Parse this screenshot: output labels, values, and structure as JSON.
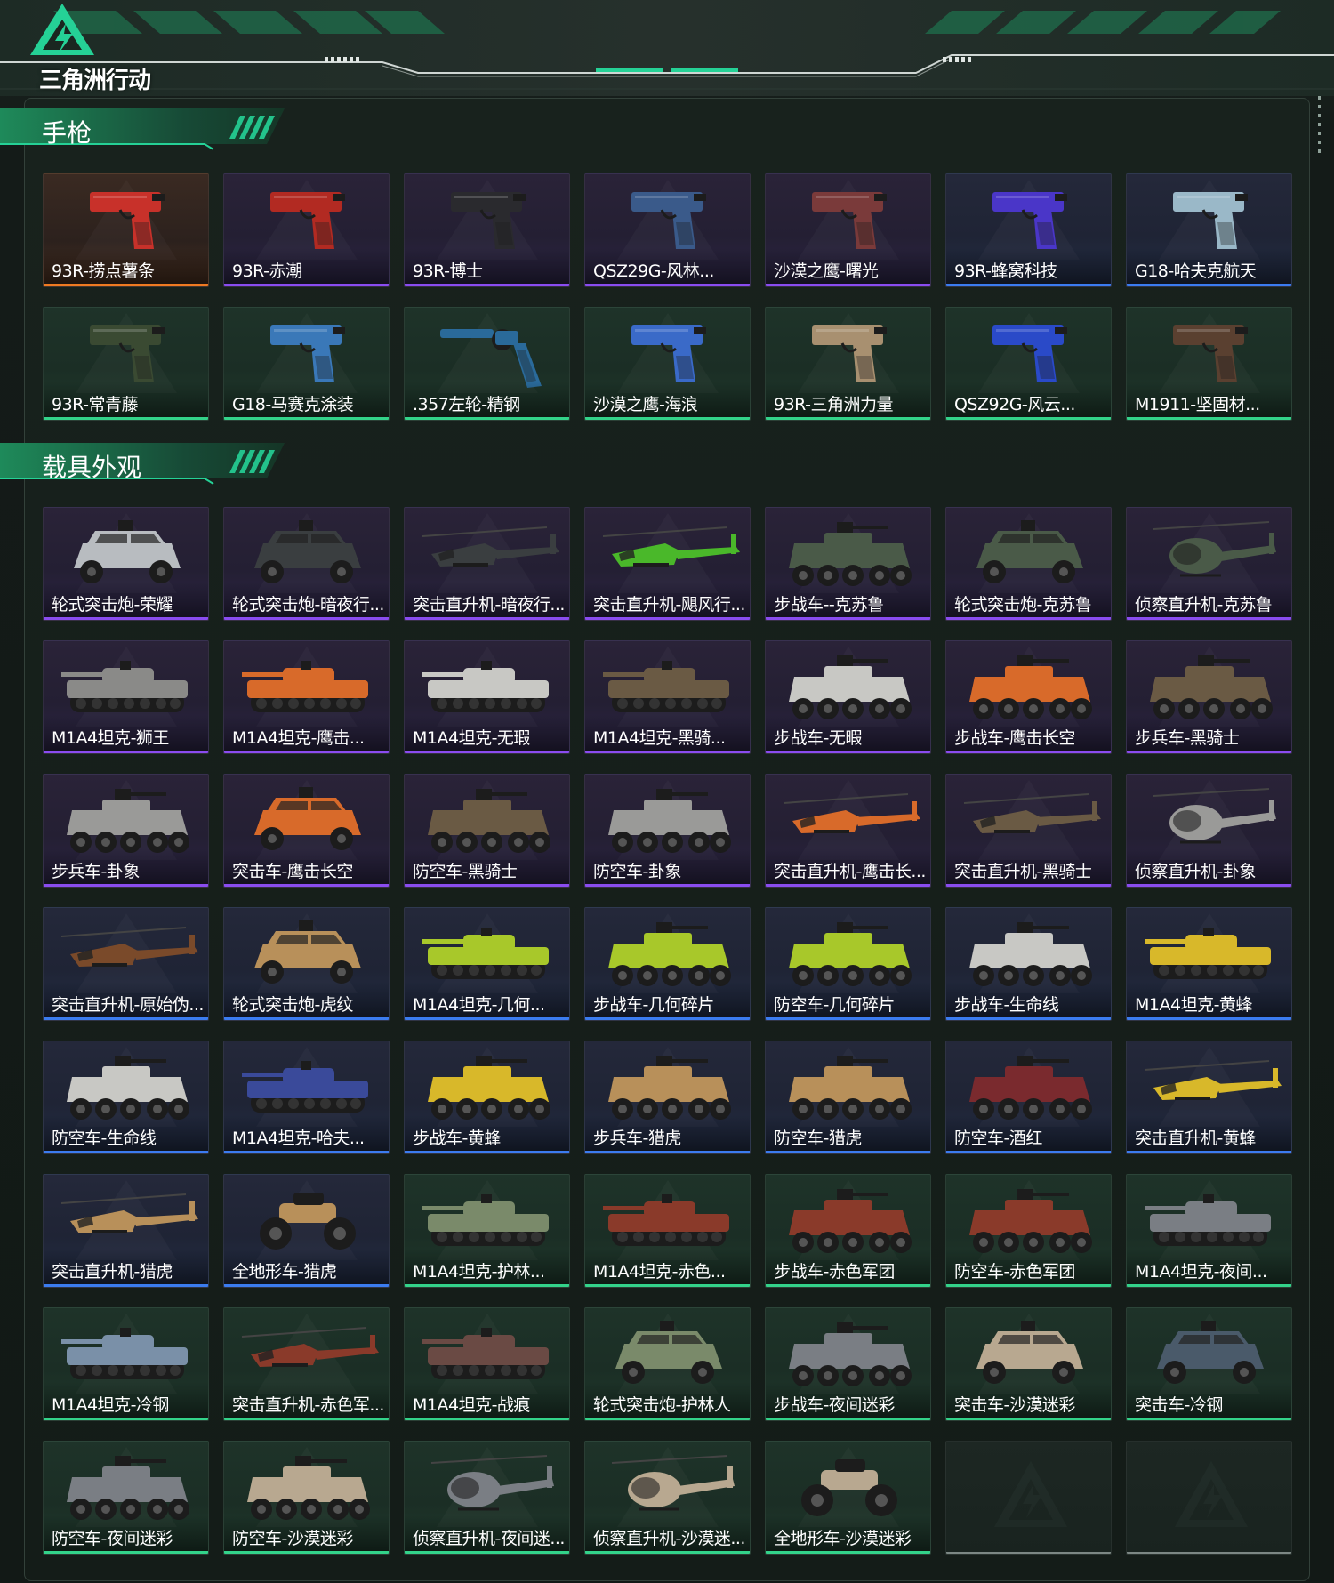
{
  "brand": {
    "name": "三角洲行动",
    "accent": "#25d196"
  },
  "rarity_colors": {
    "orange": "#f07a22",
    "purple": "#8a4cf0",
    "blue": "#3b7cf0",
    "green": "#33d38a",
    "empty": "#7c8784"
  },
  "sections": [
    {
      "title": "手枪",
      "items": [
        {
          "label": "93R-捞点薯条",
          "rarity": "orange",
          "kind": "pistol",
          "color": "#c8312a"
        },
        {
          "label": "93R-赤潮",
          "rarity": "purple",
          "kind": "pistol",
          "color": "#b22a22"
        },
        {
          "label": "93R-博士",
          "rarity": "purple",
          "kind": "pistol",
          "color": "#2a2a2e"
        },
        {
          "label": "QSZ29G-风林...",
          "rarity": "purple",
          "kind": "pistol",
          "color": "#3a5a8a"
        },
        {
          "label": "沙漠之鹰-曙光",
          "rarity": "purple",
          "kind": "pistol",
          "color": "#7a3a3a"
        },
        {
          "label": "93R-蜂窝科技",
          "rarity": "blue",
          "kind": "pistol",
          "color": "#4a36c8"
        },
        {
          "label": "G18-哈夫克航天",
          "rarity": "blue",
          "kind": "pistol",
          "color": "#9ab8c8"
        },
        {
          "label": "93R-常青藤",
          "rarity": "green",
          "kind": "pistol",
          "color": "#3a4a32"
        },
        {
          "label": "G18-马赛克涂装",
          "rarity": "green",
          "kind": "pistol",
          "color": "#3a78b8"
        },
        {
          "label": ".357左轮-精钢",
          "rarity": "green",
          "kind": "revolver",
          "color": "#2a6a9a"
        },
        {
          "label": "沙漠之鹰-海浪",
          "rarity": "green",
          "kind": "pistol",
          "color": "#3a6ac8"
        },
        {
          "label": "93R-三角洲力量",
          "rarity": "green",
          "kind": "pistol",
          "color": "#a89070"
        },
        {
          "label": "QSZ92G-风云...",
          "rarity": "green",
          "kind": "pistol",
          "color": "#2a4ac8"
        },
        {
          "label": "M1911-坚固材...",
          "rarity": "green",
          "kind": "pistol",
          "color": "#5a4030"
        }
      ]
    },
    {
      "title": "载具外观",
      "items": [
        {
          "label": "轮式突击炮-荣耀",
          "rarity": "purple",
          "kind": "car",
          "color": "#b8bcc0"
        },
        {
          "label": "轮式突击炮-暗夜行...",
          "rarity": "purple",
          "kind": "car",
          "color": "#3a3e40"
        },
        {
          "label": "突击直升机-暗夜行...",
          "rarity": "purple",
          "kind": "heli",
          "color": "#3a3e40"
        },
        {
          "label": "突击直升机-飓风行...",
          "rarity": "purple",
          "kind": "heli",
          "color": "#4ab82a"
        },
        {
          "label": "步战车--克苏鲁",
          "rarity": "purple",
          "kind": "apc",
          "color": "#4a5a48"
        },
        {
          "label": "轮式突击炮-克苏鲁",
          "rarity": "purple",
          "kind": "car",
          "color": "#4a5a48"
        },
        {
          "label": "侦察直升机-克苏鲁",
          "rarity": "purple",
          "kind": "scout",
          "color": "#4a5a48"
        },
        {
          "label": "M1A4坦克-狮王",
          "rarity": "purple",
          "kind": "tank",
          "color": "#8a8a88"
        },
        {
          "label": "M1A4坦克-鹰击...",
          "rarity": "purple",
          "kind": "tank",
          "color": "#d86a2a"
        },
        {
          "label": "M1A4坦克-无瑕",
          "rarity": "purple",
          "kind": "tank",
          "color": "#c8c8c4"
        },
        {
          "label": "M1A4坦克-黑骑...",
          "rarity": "purple",
          "kind": "tank",
          "color": "#6a5a44"
        },
        {
          "label": "步战车-无暇",
          "rarity": "purple",
          "kind": "apc",
          "color": "#c8c8c4"
        },
        {
          "label": "步战车-鹰击长空",
          "rarity": "purple",
          "kind": "apc",
          "color": "#d86a2a"
        },
        {
          "label": "步兵车-黑骑士",
          "rarity": "purple",
          "kind": "apc",
          "color": "#6a5a44"
        },
        {
          "label": "步兵车-卦象",
          "rarity": "purple",
          "kind": "apc",
          "color": "#9a9a98"
        },
        {
          "label": "突击车-鹰击长空",
          "rarity": "purple",
          "kind": "car",
          "color": "#d86a2a"
        },
        {
          "label": "防空车-黑骑士",
          "rarity": "purple",
          "kind": "apc",
          "color": "#6a5a44"
        },
        {
          "label": "防空车-卦象",
          "rarity": "purple",
          "kind": "apc",
          "color": "#9a9a98"
        },
        {
          "label": "突击直升机-鹰击长...",
          "rarity": "purple",
          "kind": "heli",
          "color": "#d86a2a"
        },
        {
          "label": "突击直升机-黑骑士",
          "rarity": "purple",
          "kind": "heli",
          "color": "#6a5a44"
        },
        {
          "label": "侦察直升机-卦象",
          "rarity": "purple",
          "kind": "scout",
          "color": "#9a9a98"
        },
        {
          "label": "突击直升机-原始伪...",
          "rarity": "blue",
          "kind": "heli",
          "color": "#7a4a2a"
        },
        {
          "label": "轮式突击炮-虎纹",
          "rarity": "blue",
          "kind": "car",
          "color": "#b8905a"
        },
        {
          "label": "M1A4坦克-几何...",
          "rarity": "blue",
          "kind": "tank",
          "color": "#a8c82a"
        },
        {
          "label": "步战车-几何碎片",
          "rarity": "blue",
          "kind": "apc",
          "color": "#a8c82a"
        },
        {
          "label": "防空车-几何碎片",
          "rarity": "blue",
          "kind": "apc",
          "color": "#a8c82a"
        },
        {
          "label": "步战车-生命线",
          "rarity": "blue",
          "kind": "apc",
          "color": "#c8c8c4"
        },
        {
          "label": "M1A4坦克-黄蜂",
          "rarity": "blue",
          "kind": "tank",
          "color": "#d8b82a"
        },
        {
          "label": "防空车-生命线",
          "rarity": "blue",
          "kind": "apc",
          "color": "#c8c8c4"
        },
        {
          "label": "M1A4坦克-哈夫...",
          "rarity": "blue",
          "kind": "tank",
          "color": "#3a4a9a"
        },
        {
          "label": "步战车-黄蜂",
          "rarity": "blue",
          "kind": "apc",
          "color": "#d8b82a"
        },
        {
          "label": "步兵车-猎虎",
          "rarity": "blue",
          "kind": "apc",
          "color": "#b8905a"
        },
        {
          "label": "防空车-猎虎",
          "rarity": "blue",
          "kind": "apc",
          "color": "#b8905a"
        },
        {
          "label": "防空车-酒红",
          "rarity": "blue",
          "kind": "apc",
          "color": "#7a2a2e"
        },
        {
          "label": "突击直升机-黄蜂",
          "rarity": "blue",
          "kind": "heli",
          "color": "#d8b82a"
        },
        {
          "label": "突击直升机-猎虎",
          "rarity": "blue",
          "kind": "heli",
          "color": "#b8905a"
        },
        {
          "label": "全地形车-猎虎",
          "rarity": "blue",
          "kind": "atv",
          "color": "#b8905a"
        },
        {
          "label": "M1A4坦克-护林...",
          "rarity": "green",
          "kind": "tank",
          "color": "#7a8a6a"
        },
        {
          "label": "M1A4坦克-赤色...",
          "rarity": "green",
          "kind": "tank",
          "color": "#8a3a2a"
        },
        {
          "label": "步战车-赤色军团",
          "rarity": "green",
          "kind": "apc",
          "color": "#8a3a2a"
        },
        {
          "label": "防空车-赤色军团",
          "rarity": "green",
          "kind": "apc",
          "color": "#8a3a2a"
        },
        {
          "label": "M1A4坦克-夜间...",
          "rarity": "green",
          "kind": "tank",
          "color": "#7a7e84"
        },
        {
          "label": "M1A4坦克-冷钢",
          "rarity": "green",
          "kind": "tank",
          "color": "#7a90a8"
        },
        {
          "label": "突击直升机-赤色军...",
          "rarity": "green",
          "kind": "heli",
          "color": "#8a3a2a"
        },
        {
          "label": "M1A4坦克-战痕",
          "rarity": "green",
          "kind": "tank",
          "color": "#6a4a44"
        },
        {
          "label": "轮式突击炮-护林人",
          "rarity": "green",
          "kind": "car",
          "color": "#7a8a6a"
        },
        {
          "label": "步战车-夜间迷彩",
          "rarity": "green",
          "kind": "apc",
          "color": "#7a7e84"
        },
        {
          "label": "突击车-沙漠迷彩",
          "rarity": "green",
          "kind": "car",
          "color": "#b8a890"
        },
        {
          "label": "突击车-冷钢",
          "rarity": "green",
          "kind": "car",
          "color": "#4a5a6a"
        },
        {
          "label": "防空车-夜间迷彩",
          "rarity": "green",
          "kind": "apc",
          "color": "#7a7e84"
        },
        {
          "label": "防空车-沙漠迷彩",
          "rarity": "green",
          "kind": "apc",
          "color": "#b8a890"
        },
        {
          "label": "侦察直升机-夜间迷...",
          "rarity": "green",
          "kind": "scout",
          "color": "#7a7e84"
        },
        {
          "label": "侦察直升机-沙漠迷...",
          "rarity": "green",
          "kind": "scout",
          "color": "#b8a890"
        },
        {
          "label": "全地形车-沙漠迷彩",
          "rarity": "green",
          "kind": "atv",
          "color": "#b8a890"
        },
        {
          "label": "",
          "rarity": "empty",
          "kind": "empty",
          "color": "#2a3430"
        },
        {
          "label": "",
          "rarity": "empty",
          "kind": "empty",
          "color": "#2a3430"
        }
      ]
    }
  ]
}
